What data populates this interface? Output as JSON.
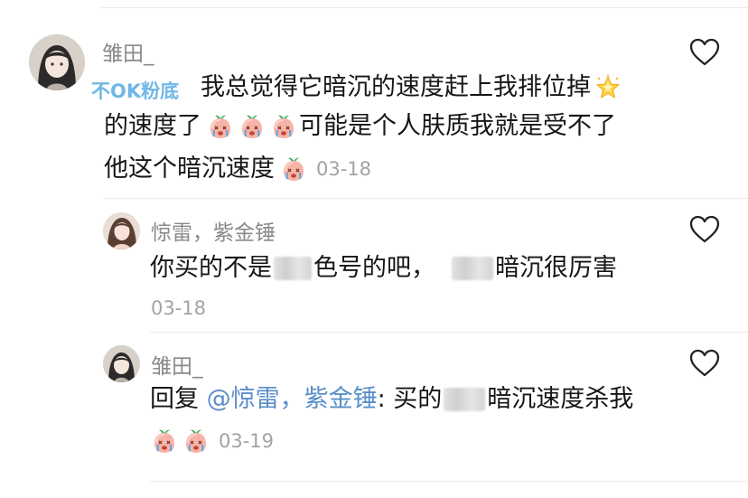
{
  "comments": [
    {
      "username": "雏田_",
      "badge": "不OK粉底",
      "line1": "我总觉得它暗沉的速度赶上我排位掉",
      "line2a": "的速度了",
      "line2b": "可能是个人肤质我就是受不了",
      "line3": "他这个暗沉速度",
      "date": "03-18"
    },
    {
      "username": "惊雷，紫金锤",
      "text_a": "你买的不是",
      "text_b": "色号的吧，",
      "text_c": "暗沉很厉害",
      "date": "03-18"
    },
    {
      "username": "雏田_",
      "reply_prefix": "回复 ",
      "mention": "@惊雷，紫金锤",
      "text_a": ": 买的",
      "text_b": "暗沉速度杀我",
      "date": "03-19"
    }
  ],
  "icons": {
    "like": "heart-outline-icon",
    "sparkle": "glowing-star-icon",
    "sad": "peach-crying-icon"
  },
  "colors": {
    "username": "#8a8a8a",
    "badge": "#6fb7e6",
    "mention": "#5b8fc9",
    "date": "#a3a3a3"
  }
}
